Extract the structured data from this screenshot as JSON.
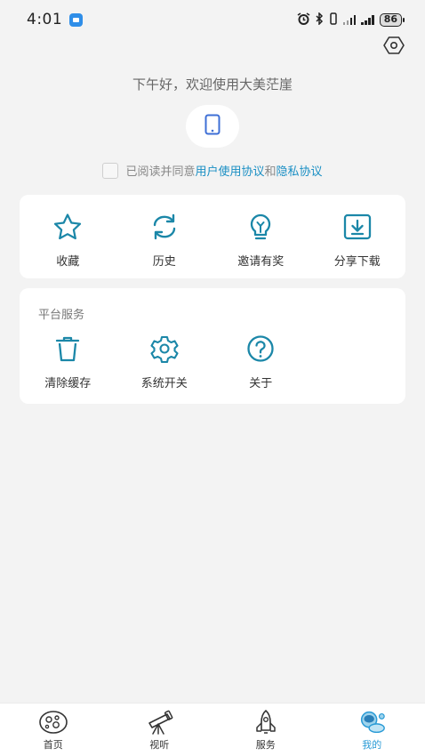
{
  "status_bar": {
    "time": "4:01",
    "battery": "86",
    "icons": [
      "app-notification-icon",
      "alarm-icon",
      "bluetooth-icon",
      "vibrate-icon",
      "signal-icon",
      "signal-icon"
    ]
  },
  "header": {
    "settings_icon": "hexagon-settings-icon",
    "greeting": "下午好，欢迎使用大美茫崖"
  },
  "agreement": {
    "prefix": "已阅读并同意",
    "user_agreement": "用户使用协议",
    "conjunction": "和",
    "privacy_agreement": "隐私协议"
  },
  "quick_actions": [
    {
      "label": "收藏",
      "icon": "star-icon"
    },
    {
      "label": "历史",
      "icon": "refresh-icon"
    },
    {
      "label": "邀请有奖",
      "icon": "lightbulb-icon"
    },
    {
      "label": "分享下载",
      "icon": "download-icon"
    }
  ],
  "services": {
    "title": "平台服务",
    "items": [
      {
        "label": "清除缓存",
        "icon": "trash-icon"
      },
      {
        "label": "系统开关",
        "icon": "gear-icon"
      },
      {
        "label": "关于",
        "icon": "question-icon"
      }
    ]
  },
  "tabbar": {
    "items": [
      {
        "label": "首页",
        "icon": "home-planet-icon"
      },
      {
        "label": "视听",
        "icon": "telescope-icon"
      },
      {
        "label": "服务",
        "icon": "rocket-icon"
      },
      {
        "label": "我的",
        "icon": "astronaut-icon",
        "active": true
      }
    ]
  },
  "colors": {
    "accent": "#1a8fc4",
    "icon_stroke": "#1b87a8",
    "background": "#f3f3f3",
    "card": "#ffffff",
    "active_tab": "#2a9bd6"
  }
}
